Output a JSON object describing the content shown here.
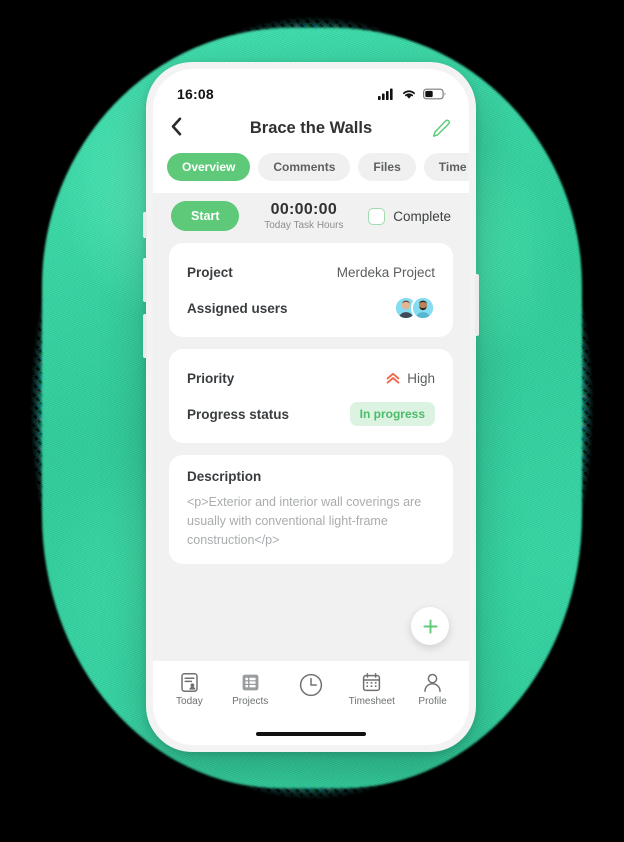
{
  "status_bar": {
    "time": "16:08",
    "signal_icon": "signal-bars-icon",
    "wifi_icon": "wifi-icon",
    "battery_icon": "battery-icon",
    "battery_level_pct": 40
  },
  "header": {
    "back_icon": "chevron-left-icon",
    "title": "Brace the Walls",
    "edit_icon": "pencil-icon"
  },
  "tabs": [
    {
      "label": "Overview",
      "active": true
    },
    {
      "label": "Comments",
      "active": false
    },
    {
      "label": "Files",
      "active": false
    },
    {
      "label": "Time Entries",
      "active": false
    }
  ],
  "timer": {
    "start_label": "Start",
    "value": "00:00:00",
    "caption": "Today Task Hours",
    "complete_label": "Complete",
    "complete_checked": false
  },
  "details_card": {
    "project_label": "Project",
    "project_value": "Merdeka Project",
    "assigned_label": "Assigned users",
    "assigned_count": 2
  },
  "status_card": {
    "priority_label": "Priority",
    "priority_value": "High",
    "priority_icon": "double-chevron-up-icon",
    "progress_label": "Progress status",
    "progress_value": "In progress"
  },
  "description_card": {
    "title": "Description",
    "body": "<p>Exterior and interior wall coverings are usually with conventional light-frame construction</p>"
  },
  "fab": {
    "icon": "plus-icon"
  },
  "bottom_nav": [
    {
      "label": "Today",
      "icon": "document-person-icon"
    },
    {
      "label": "Projects",
      "icon": "list-icon"
    },
    {
      "label": "",
      "icon": "clock-icon"
    },
    {
      "label": "Timesheet",
      "icon": "calendar-icon"
    },
    {
      "label": "Profile",
      "icon": "person-icon"
    }
  ],
  "colors": {
    "accent_green": "#5fc97a",
    "badge_bg": "#ddf3e2",
    "badge_text": "#4cbb6b",
    "priority_orange": "#f0694b",
    "screen_bg": "#f1f1f1",
    "blob_green": "#2ecb98",
    "blob_cyan": "#00e5ff",
    "page_bg": "#000000"
  }
}
